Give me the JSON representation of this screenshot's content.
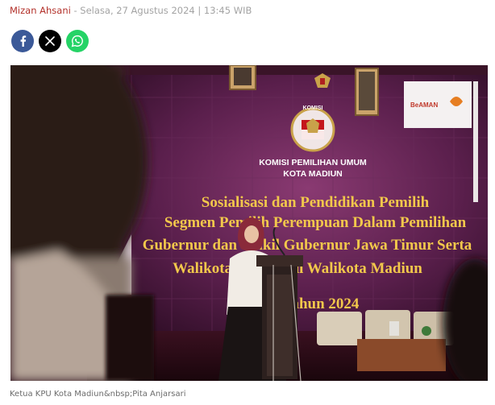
{
  "byline": {
    "author": "Mizan Ahsani",
    "separator": " - ",
    "datetime": "Selasa, 27 Agustus 2024 | 13:45 WIB"
  },
  "share": {
    "buttons": [
      {
        "name": "facebook",
        "icon": "facebook-icon",
        "color": "#3b5998"
      },
      {
        "name": "x",
        "icon": "x-icon",
        "color": "#000000"
      },
      {
        "name": "whatsapp",
        "icon": "whatsapp-icon",
        "color": "#25d366"
      }
    ]
  },
  "photo": {
    "banner_org": "KOMISI PEMILIHAN UMUM",
    "banner_city": "KOTA MADIUN",
    "logo_top": "KOMISI",
    "logo_bottom": "PEMILIHAN UMUM",
    "banner_lines": [
      "Sosialisasi dan Pendidikan Pemilih",
      "Segmen Pemilih Perempuan Dalam Pemilihan",
      "Gubernur dan Wakil Gubernur Jawa Timur Serta",
      "Walikota dan Wakil Walikota Madiun",
      "Tahun 2024"
    ],
    "sponsor": "BeAMAN"
  },
  "caption": "Ketua KPU Kota Madiun&nbsp;Pita Anjarsari"
}
